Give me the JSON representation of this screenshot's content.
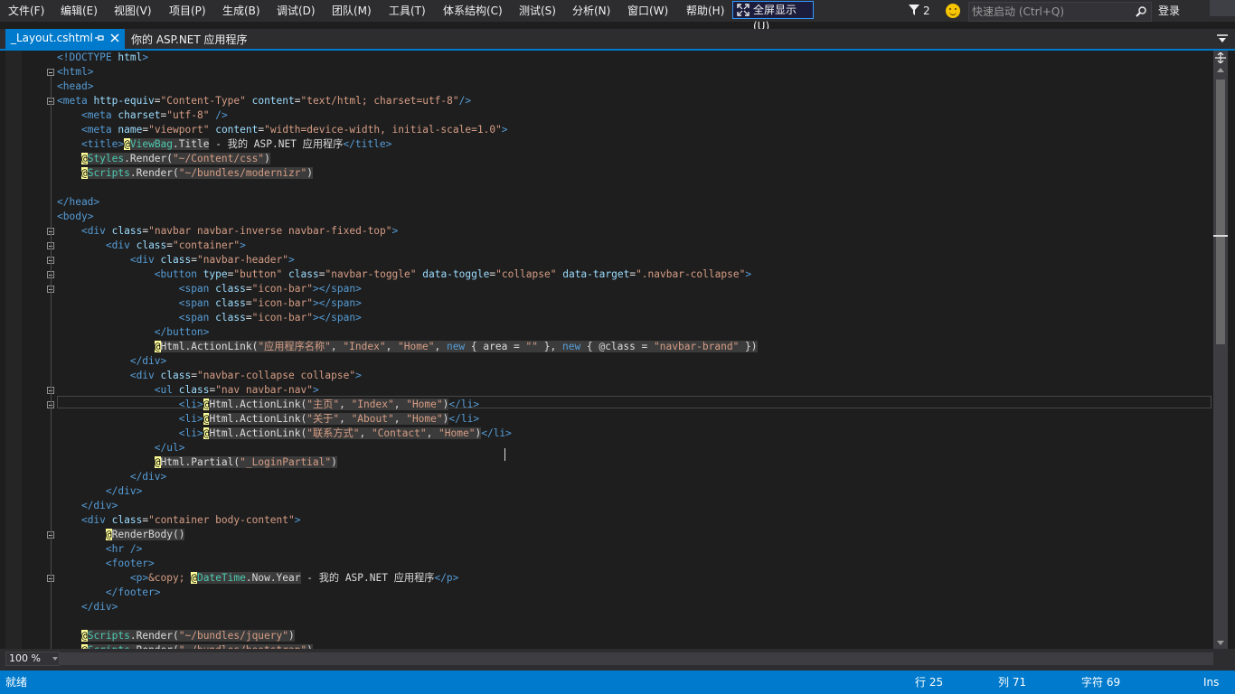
{
  "menubar": {
    "items": [
      "文件(F)",
      "编辑(E)",
      "视图(V)",
      "项目(P)",
      "生成(B)",
      "调试(D)",
      "团队(M)",
      "工具(T)",
      "体系结构(C)",
      "测试(S)",
      "分析(N)",
      "窗口(W)",
      "帮助(H)"
    ],
    "fullscreen_label": "全屏显示(U)",
    "notification_count": "2",
    "quicklaunch_placeholder": "快速启动 (Ctrl+Q)",
    "signin_label": "登录"
  },
  "tabs": {
    "active_label": "_Layout.cshtml",
    "project_label": "你的 ASP.NET 应用程序"
  },
  "editor": {
    "code_lines": [
      "<!DOCTYPE html>",
      "<html>",
      "<head>",
      "<meta http-equiv=\"Content-Type\" content=\"text/html; charset=utf-8\"/>",
      "    <meta charset=\"utf-8\" />",
      "    <meta name=\"viewport\" content=\"width=device-width, initial-scale=1.0\">",
      "    <title>@ViewBag.Title - 我的 ASP.NET 应用程序</title>",
      "    @Styles.Render(\"~/Content/css\")",
      "    @Scripts.Render(\"~/bundles/modernizr\")",
      "",
      "</head>",
      "<body>",
      "    <div class=\"navbar navbar-inverse navbar-fixed-top\">",
      "        <div class=\"container\">",
      "            <div class=\"navbar-header\">",
      "                <button type=\"button\" class=\"navbar-toggle\" data-toggle=\"collapse\" data-target=\".navbar-collapse\">",
      "                    <span class=\"icon-bar\"></span>",
      "                    <span class=\"icon-bar\"></span>",
      "                    <span class=\"icon-bar\"></span>",
      "                </button>",
      "                @Html.ActionLink(\"应用程序名称\", \"Index\", \"Home\", new { area = \"\" }, new { @class = \"navbar-brand\" })",
      "            </div>",
      "            <div class=\"navbar-collapse collapse\">",
      "                <ul class=\"nav navbar-nav\">",
      "                    <li>@Html.ActionLink(\"主页\", \"Index\", \"Home\")</li>",
      "                    <li>@Html.ActionLink(\"关于\", \"About\", \"Home\")</li>",
      "                    <li>@Html.ActionLink(\"联系方式\", \"Contact\", \"Home\")</li>",
      "                </ul>",
      "                @Html.Partial(\"_LoginPartial\")",
      "            </div>",
      "        </div>",
      "    </div>",
      "    <div class=\"container body-content\">",
      "        @RenderBody()",
      "        <hr />",
      "        <footer>",
      "            <p>&copy; @DateTime.Now.Year - 我的 ASP.NET 应用程序</p>",
      "        </footer>",
      "    </div>",
      "",
      "    @Scripts.Render(\"~/bundles/jquery\")",
      "    @Scripts.Render(\"~/bundles/bootstrap\")"
    ]
  },
  "bottombar": {
    "zoom": "100 %"
  },
  "statusbar": {
    "ready": "就绪",
    "line": "行 25",
    "col": "列 71",
    "char": "字符 69",
    "mode": "Ins"
  },
  "colors": {
    "accent": "#007acc",
    "tag": "#569cd6",
    "attribute": "#9cdcfe",
    "string": "#d69d85",
    "razor_marker": "#ffff99",
    "type": "#4ec9b0"
  }
}
